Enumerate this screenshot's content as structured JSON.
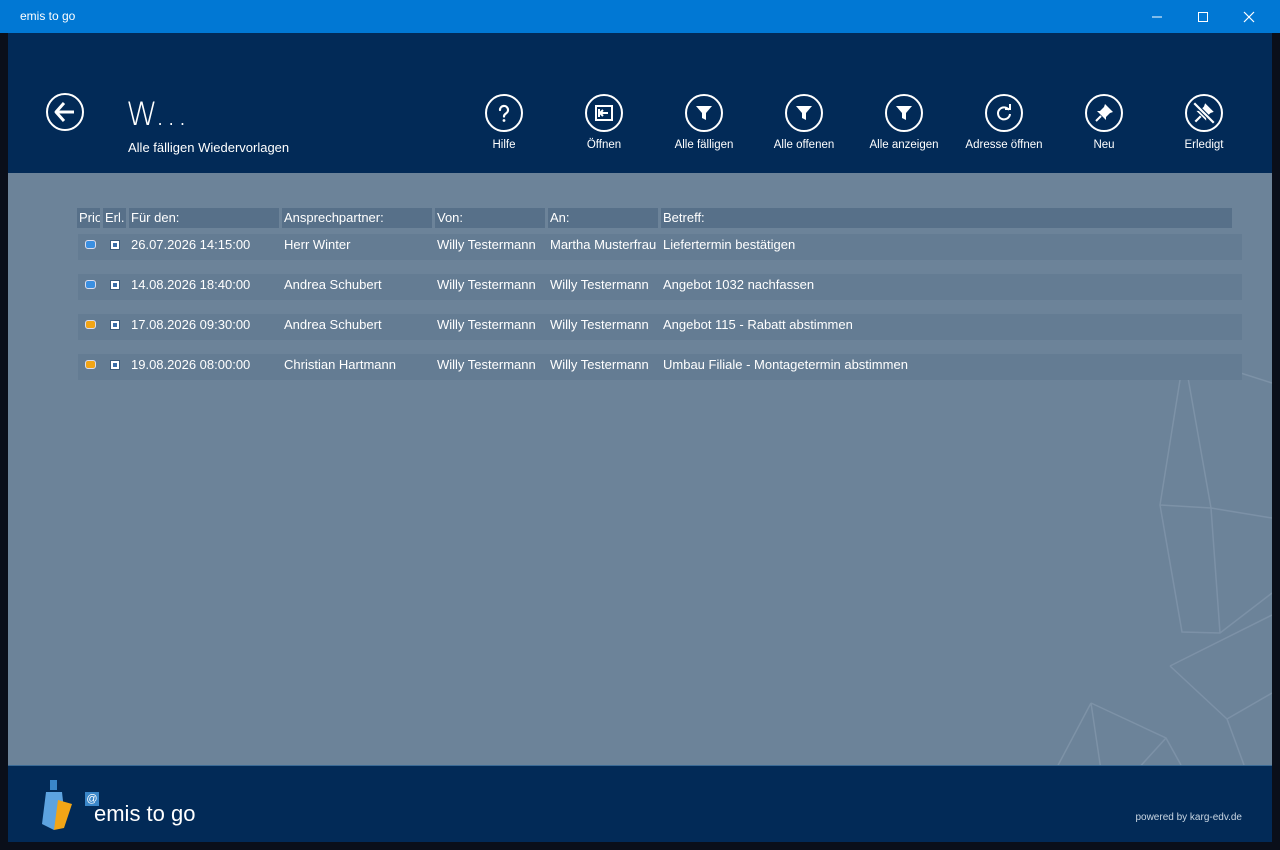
{
  "window": {
    "title": "emis to go"
  },
  "header": {
    "title": "W...",
    "subtitle": "Alle fälligen Wiedervorlagen"
  },
  "toolbar": [
    {
      "id": "help",
      "label": "Hilfe",
      "icon": "question-icon"
    },
    {
      "id": "open",
      "label": "Öffnen",
      "icon": "open-icon"
    },
    {
      "id": "all-due",
      "label": "Alle fälligen",
      "icon": "filter-icon"
    },
    {
      "id": "all-open",
      "label": "Alle offenen",
      "icon": "filter-icon"
    },
    {
      "id": "show-all",
      "label": "Alle anzeigen",
      "icon": "filter-icon"
    },
    {
      "id": "open-address",
      "label": "Adresse öffnen",
      "icon": "refresh-icon"
    },
    {
      "id": "new",
      "label": "Neu",
      "icon": "pin-icon"
    },
    {
      "id": "done",
      "label": "Erledigt",
      "icon": "unpin-icon"
    }
  ],
  "table": {
    "columns": [
      "Prio",
      "Erl.",
      "Für den:",
      "Ansprechpartner:",
      "Von:",
      "An:",
      "Betreff:"
    ],
    "rows": [
      {
        "prio": "blue",
        "for": "26.07.2026 14:15:00",
        "contact": "Herr Winter",
        "from": "Willy Testermann",
        "to": "Martha Musterfrau",
        "subject": "Liefertermin bestätigen"
      },
      {
        "prio": "blue",
        "for": "14.08.2026 18:40:00",
        "contact": "Andrea Schubert",
        "from": "Willy Testermann",
        "to": "Willy Testermann",
        "subject": "Angebot 1032 nachfassen"
      },
      {
        "prio": "orange",
        "for": "17.08.2026 09:30:00",
        "contact": "Andrea Schubert",
        "from": "Willy Testermann",
        "to": "Willy Testermann",
        "subject": "Angebot 115 - Rabatt abstimmen"
      },
      {
        "prio": "orange",
        "for": "19.08.2026 08:00:00",
        "contact": "Christian Hartmann",
        "from": "Willy Testermann",
        "to": "Willy Testermann",
        "subject": "Umbau Filiale - Montagetermin abstimmen"
      }
    ]
  },
  "footer": {
    "logo": "emis to go",
    "logo_at": "@",
    "powered": "powered by karg-edv.de"
  },
  "colors": {
    "titlebar": "#0178d4",
    "header": "#022a57",
    "content": "#6c8399",
    "prio_blue": "#3b8fe0",
    "prio_orange": "#f2a516"
  }
}
